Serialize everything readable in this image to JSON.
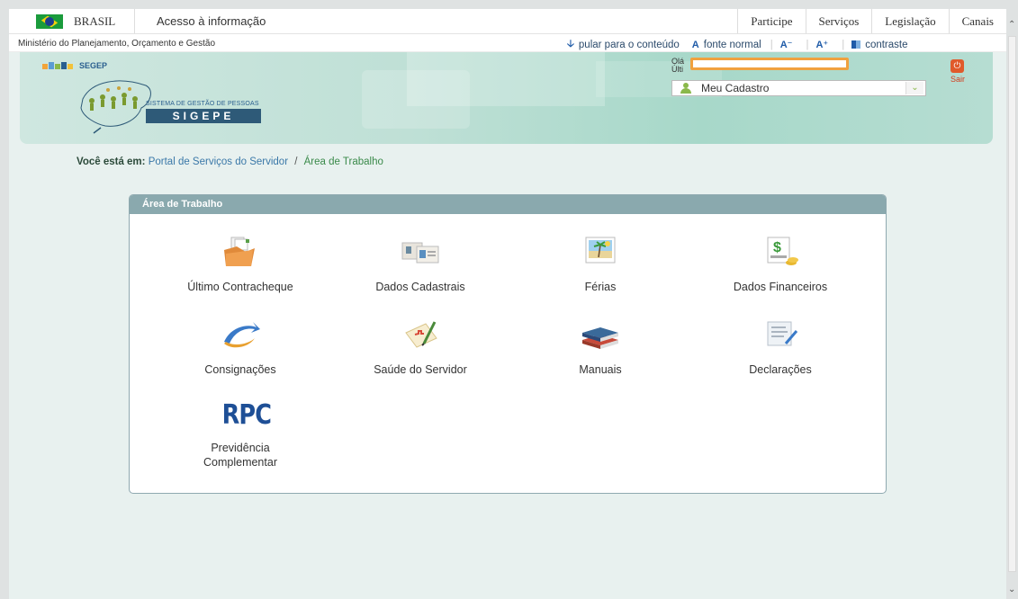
{
  "govbar": {
    "brand": "BRASIL",
    "access": "Acesso à informação",
    "menu": [
      "Participe",
      "Serviços",
      "Legislação",
      "Canais"
    ]
  },
  "subbar": {
    "ministry": "Ministério do Planejamento, Orçamento e Gestão",
    "skip": "pular para o conteúdo",
    "font_icon": "A",
    "font_normal": "fonte normal",
    "font_down": "A⁻",
    "font_up": "A⁺",
    "contrast": "contraste"
  },
  "header": {
    "segep": "SEGEP",
    "system_subtitle": "SISTEMA DE GESTÃO DE PESSOAS",
    "system_name": "SIGEPE",
    "greeting": "Olá",
    "last_access": "Últi",
    "profile_select": "Meu Cadastro",
    "logout": "Sair"
  },
  "breadcrumb": {
    "label": "Você está em:",
    "items": [
      "Portal de Serviços do Servidor",
      "Área de Trabalho"
    ]
  },
  "panel": {
    "title": "Área de Trabalho",
    "items": [
      {
        "label": "Último Contracheque",
        "icon": "folder-icon"
      },
      {
        "label": "Dados Cadastrais",
        "icon": "id-cards-icon"
      },
      {
        "label": "Férias",
        "icon": "vacation-photo-icon"
      },
      {
        "label": "Dados Financeiros",
        "icon": "money-icon"
      },
      {
        "label": "Consignações",
        "icon": "arrow-swoosh-icon"
      },
      {
        "label": "Saúde do Servidor",
        "icon": "health-check-icon"
      },
      {
        "label": "Manuais",
        "icon": "books-icon"
      },
      {
        "label": "Declarações",
        "icon": "document-pen-icon"
      },
      {
        "label": "Previdência Complementar",
        "icon": "rpc-icon",
        "icon_text": "RPC"
      }
    ]
  },
  "colors": {
    "panel_header": "#8aa9ae",
    "header_banner": "#bfe0d6",
    "logout": "#e05a2b",
    "redaction_border": "#f0a13f"
  }
}
